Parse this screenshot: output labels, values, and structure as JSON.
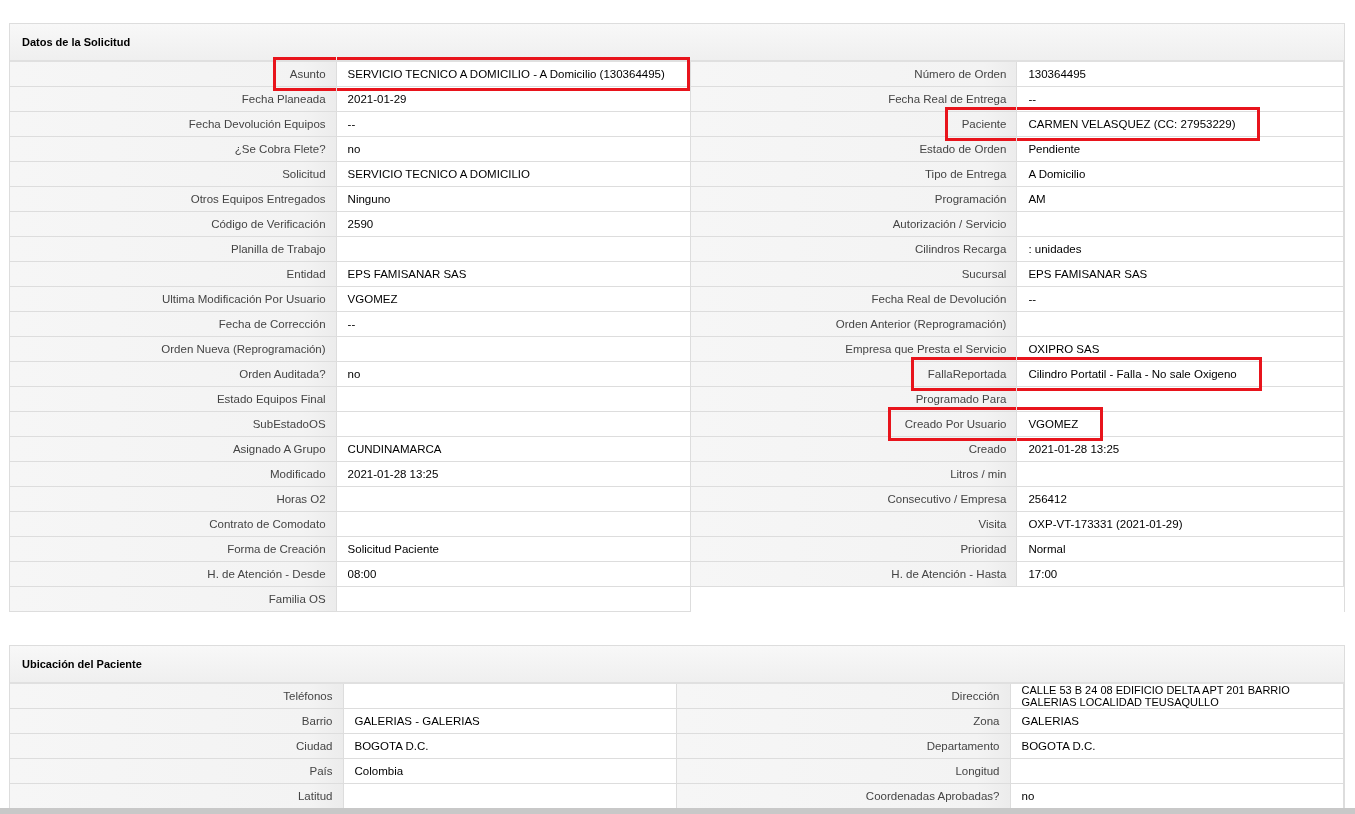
{
  "sections": [
    {
      "title": "Datos de la Solicitud",
      "left": [
        {
          "label": "Asunto",
          "value": "SERVICIO TECNICO A DOMICILIO - A Domicilio (130364495)",
          "highlighted": true
        },
        {
          "label": "Fecha Planeada",
          "value": "2021-01-29",
          "highlighted": false
        },
        {
          "label": "Fecha Devolución Equipos",
          "value": "--",
          "highlighted": false
        },
        {
          "label": "¿Se Cobra Flete?",
          "value": "no",
          "highlighted": false
        },
        {
          "label": "Solicitud",
          "value": "SERVICIO TECNICO A DOMICILIO",
          "highlighted": false
        },
        {
          "label": "Otros Equipos Entregados",
          "value": "Ninguno",
          "highlighted": false
        },
        {
          "label": "Código de Verificación",
          "value": "2590",
          "highlighted": false
        },
        {
          "label": "Planilla de Trabajo",
          "highlighted": false
        },
        {
          "label": "Entidad",
          "value": "EPS FAMISANAR SAS",
          "highlighted": false
        },
        {
          "label": "Ultima Modificación Por Usuario",
          "value": "VGOMEZ",
          "highlighted": false
        },
        {
          "label": "Fecha de Corrección",
          "value": "--",
          "highlighted": false
        },
        {
          "label": "Orden Nueva (Reprogramación)",
          "highlighted": false
        },
        {
          "label": "Orden Auditada?",
          "value": "no",
          "highlighted": false
        },
        {
          "label": "Estado Equipos Final",
          "highlighted": false
        },
        {
          "label": "SubEstadoOS",
          "highlighted": false
        },
        {
          "label": "Asignado A Grupo",
          "value": "CUNDINAMARCA",
          "highlighted": false
        },
        {
          "label": "Modificado",
          "value": "2021-01-28 13:25",
          "highlighted": false
        },
        {
          "label": "Horas O2",
          "highlighted": false
        },
        {
          "label": "Contrato de Comodato",
          "highlighted": false
        },
        {
          "label": "Forma de Creación",
          "value": "Solicitud Paciente",
          "highlighted": false
        },
        {
          "label": "H. de Atención - Desde",
          "value": "08:00",
          "highlighted": false
        },
        {
          "label": "Familia OS",
          "highlighted": false
        }
      ],
      "right": [
        {
          "label": "Número de Orden",
          "value": "130364495",
          "highlighted": false
        },
        {
          "label": "Fecha Real de Entrega",
          "value": "--",
          "highlighted": false
        },
        {
          "label": "Paciente",
          "value": "CARMEN VELASQUEZ (CC: 27953229)",
          "highlighted": true
        },
        {
          "label": "Estado de Orden",
          "value": "Pendiente",
          "highlighted": false
        },
        {
          "label": "Tipo de Entrega",
          "value": "A Domicilio",
          "highlighted": false
        },
        {
          "label": "Programación",
          "value": "AM",
          "highlighted": false
        },
        {
          "label": "Autorización / Servicio",
          "highlighted": false
        },
        {
          "label": "Cilindros Recarga",
          "value": ": unidades",
          "highlighted": false
        },
        {
          "label": "Sucursal",
          "value": "EPS FAMISANAR SAS",
          "highlighted": false
        },
        {
          "label": "Fecha Real de Devolución",
          "value": "--",
          "highlighted": false
        },
        {
          "label": "Orden Anterior (Reprogramación)",
          "highlighted": false
        },
        {
          "label": "Empresa que Presta el Servicio",
          "value": "OXIPRO SAS",
          "highlighted": false
        },
        {
          "label": "FallaReportada",
          "value": "Cilindro Portatil - Falla - No sale Oxigeno",
          "highlighted": true
        },
        {
          "label": "Programado Para",
          "highlighted": false
        },
        {
          "label": "Creado Por Usuario",
          "value": "VGOMEZ",
          "highlighted": true
        },
        {
          "label": "Creado",
          "value": "2021-01-28 13:25",
          "highlighted": false
        },
        {
          "label": "Litros / min",
          "highlighted": false
        },
        {
          "label": "Consecutivo / Empresa",
          "value": "256412",
          "highlighted": false
        },
        {
          "label": "Visita",
          "value": "OXP-VT-173331 (2021-01-29)",
          "highlighted": false
        },
        {
          "label": "Prioridad",
          "value": "Normal",
          "highlighted": false
        },
        {
          "label": "H. de Atención - Hasta",
          "value": "17:00",
          "highlighted": false
        }
      ]
    },
    {
      "title": "Ubicación del Paciente",
      "left": [
        {
          "label": "Teléfonos",
          "highlighted": false
        },
        {
          "label": "Barrio",
          "value": "GALERIAS - GALERIAS",
          "highlighted": false
        },
        {
          "label": "Ciudad",
          "value": "BOGOTA D.C.",
          "highlighted": false
        },
        {
          "label": "País",
          "value": "Colombia",
          "highlighted": false
        },
        {
          "label": "Latitud",
          "highlighted": false
        }
      ],
      "right": [
        {
          "label": "Dirección",
          "value": "CALLE 53 B 24 08 EDIFICIO DELTA APT 201 BARRIO GALERIAS LOCALIDAD TEUSAQULLO",
          "highlighted": false
        },
        {
          "label": "Zona",
          "value": "GALERIAS",
          "highlighted": false
        },
        {
          "label": "Departamento",
          "value": "BOGOTA D.C.",
          "highlighted": false
        },
        {
          "label": "Longitud",
          "highlighted": false
        },
        {
          "label": "Coordenadas Aprobadas?",
          "value": "no",
          "highlighted": false
        }
      ]
    }
  ]
}
